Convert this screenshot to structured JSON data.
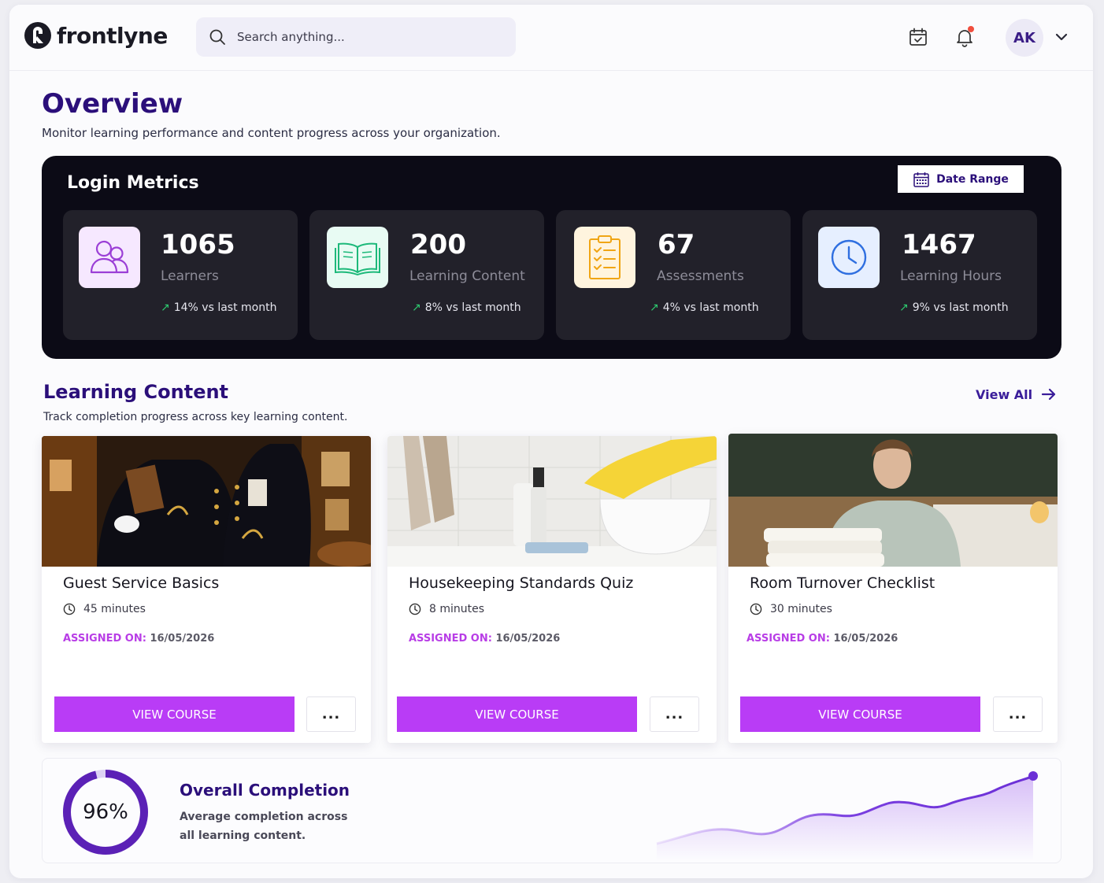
{
  "app": {
    "name": "frontlyne"
  },
  "search": {
    "placeholder": "Search anything..."
  },
  "header": {
    "avatar_initials": "AK"
  },
  "overview": {
    "title": "Overview",
    "subtitle": "Monitor learning performance and content progress across your organization."
  },
  "login_metrics": {
    "title": "Login Metrics",
    "date_range_label": "Date Range",
    "cards": [
      {
        "value": "1065",
        "label": "Learners",
        "delta": "14% vs last month",
        "icon": "users-icon",
        "icon_bg": "#f6e8ff",
        "icon_color": "#9b3fd6"
      },
      {
        "value": "200",
        "label": "Learning Content",
        "delta": "8% vs last month",
        "icon": "book-icon",
        "icon_bg": "#e8fbf3",
        "icon_color": "#1db97a"
      },
      {
        "value": "67",
        "label": "Assessments",
        "delta": "4% vs last month",
        "icon": "checklist-icon",
        "icon_bg": "#fff4de",
        "icon_color": "#f0a514"
      },
      {
        "value": "1467",
        "label": "Learning Hours",
        "delta": "9% vs last month",
        "icon": "clock-icon",
        "icon_bg": "#e6efff",
        "icon_color": "#2f6fe0"
      }
    ]
  },
  "learning_content": {
    "title": "Learning Content",
    "subtitle": "Track completion progress across key learning content.",
    "view_all_label": "View All",
    "courses": [
      {
        "title": "Guest Service Basics",
        "duration": "45 minutes",
        "assigned_label": "ASSIGNED ON:",
        "assigned_date": "16/05/2026",
        "view_label": "VIEW COURSE",
        "more_label": "..."
      },
      {
        "title": "Housekeeping Standards Quiz",
        "duration": "8 minutes",
        "assigned_label": "ASSIGNED ON:",
        "assigned_date": "16/05/2026",
        "view_label": "VIEW COURSE",
        "more_label": "..."
      },
      {
        "title": "Room Turnover Checklist",
        "duration": "30 minutes",
        "assigned_label": "ASSIGNED ON:",
        "assigned_date": "16/05/2026",
        "view_label": "VIEW COURSE",
        "more_label": "..."
      }
    ]
  },
  "overall_completion": {
    "percent_label": "96%",
    "percent": 96,
    "title": "Overall Completion",
    "subtitle": "Average completion across all learning content."
  },
  "colors": {
    "brand_purple": "#2b0f7a",
    "accent_violet": "#b93cf6",
    "ring": "#5b21b6",
    "positive": "#2ecb6f"
  }
}
